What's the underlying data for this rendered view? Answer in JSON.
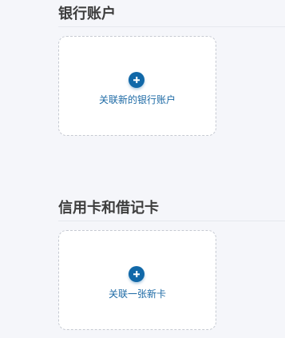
{
  "bank_section": {
    "title": "银行账户",
    "add_label": "关联新的银行账户",
    "icon": "plus-circle-icon"
  },
  "card_section": {
    "title": "信用卡和借记卡",
    "add_label": "关联一张新卡",
    "icon": "plus-circle-icon"
  },
  "colors": {
    "accent": "#1168a8",
    "link_text": "#1d6aa5",
    "heading": "#3d3d3d",
    "background": "#f5f6fa"
  }
}
